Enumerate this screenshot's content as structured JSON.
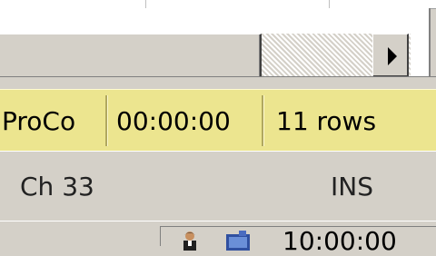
{
  "summary": {
    "company": "ProCo",
    "elapsed": "00:00:00",
    "rows": "11 rows"
  },
  "status": {
    "position": "Ch 33",
    "mode": "INS"
  },
  "tray": {
    "clock": "10:00:00",
    "icons": [
      "person-icon",
      "monitor-icon"
    ]
  },
  "colors": {
    "summary_bar": "#ece58f",
    "chrome": "#d4d0c8"
  }
}
